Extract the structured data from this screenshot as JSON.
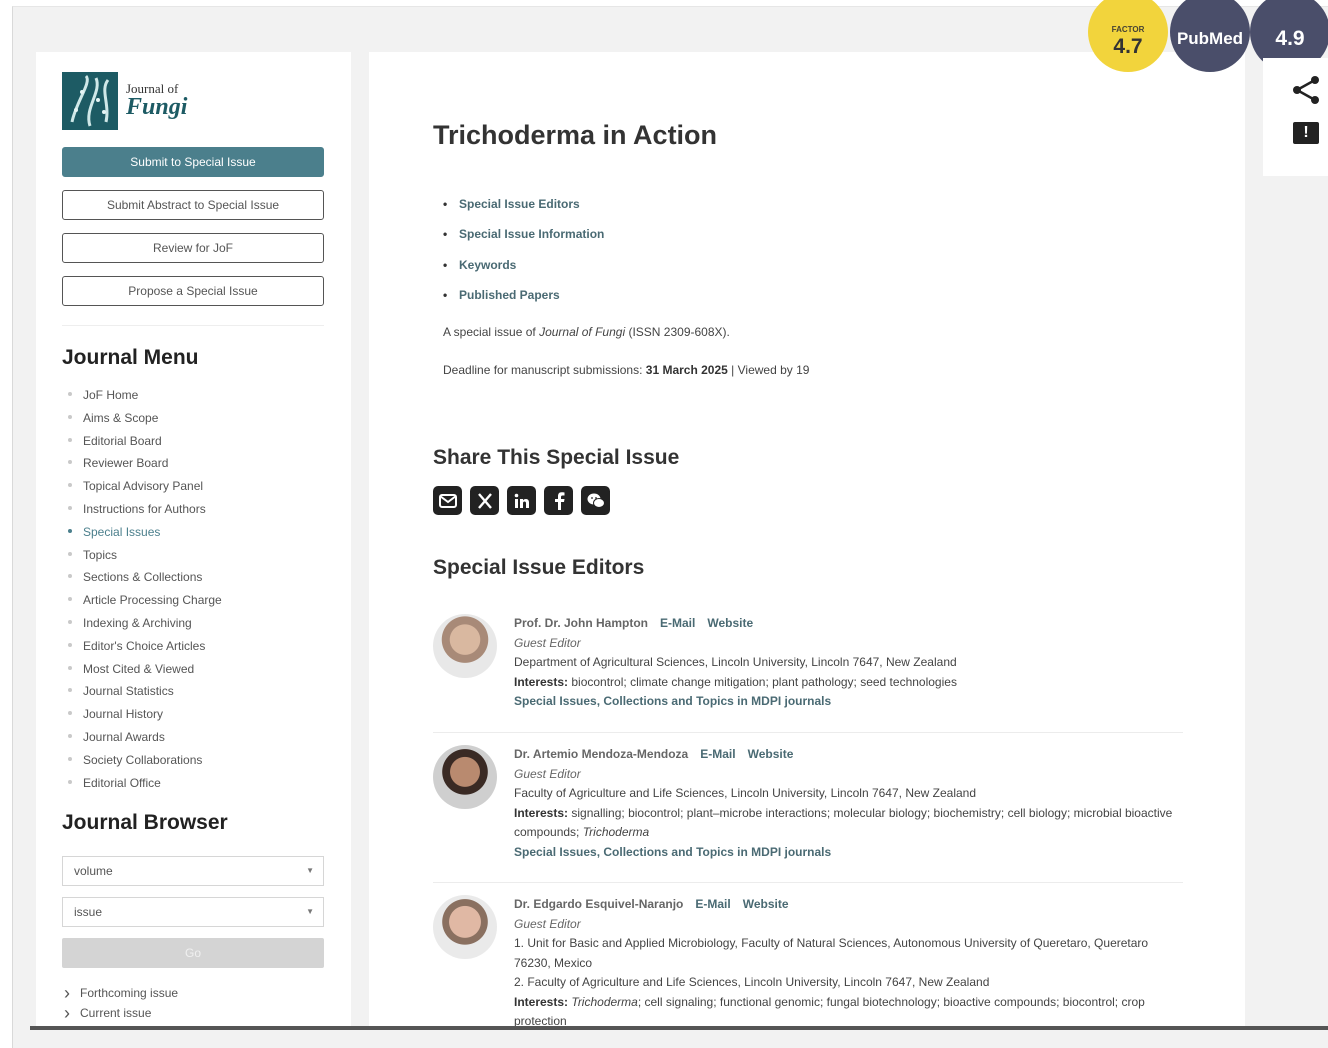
{
  "journal": {
    "small": "Journal of",
    "big": "Fungi"
  },
  "sidebar": {
    "buttons": [
      "Submit to Special Issue",
      "Submit Abstract to Special Issue",
      "Review for JoF",
      "Propose a Special Issue"
    ],
    "menu_title": "Journal Menu",
    "menu": [
      "JoF Home",
      "Aims & Scope",
      "Editorial Board",
      "Reviewer Board",
      "Topical Advisory Panel",
      "Instructions for Authors",
      "Special Issues",
      "Topics",
      "Sections & Collections",
      "Article Processing Charge",
      "Indexing & Archiving",
      "Editor's Choice Articles",
      "Most Cited & Viewed",
      "Journal Statistics",
      "Journal History",
      "Journal Awards",
      "Society Collaborations",
      "Editorial Office"
    ],
    "active_menu": "Special Issues",
    "browser_title": "Journal Browser",
    "volume_select": "volume",
    "issue_select": "issue",
    "go_label": "Go",
    "browse_links": [
      "Forthcoming issue",
      "Current issue"
    ]
  },
  "badges": {
    "impact_label": "FACTOR",
    "impact_value": "4.7",
    "pubmed": "PubMed",
    "citescore_value": "4.9"
  },
  "main": {
    "title": "Trichoderma in Action",
    "toc": [
      "Special Issue Editors",
      "Special Issue Information",
      "Keywords",
      "Published Papers"
    ],
    "issue_line": {
      "prefix": "A special issue of ",
      "journal": "Journal of Fungi",
      "suffix": " (ISSN 2309-608X)."
    },
    "deadline": {
      "prefix": "Deadline for manuscript submissions: ",
      "date": "31 March 2025",
      "suffix": " | Viewed by 19"
    },
    "share_heading": "Share This Special Issue",
    "share_icons": [
      "email-icon",
      "x-icon",
      "linkedin-icon",
      "facebook-icon",
      "wechat-icon"
    ],
    "editors_heading": "Special Issue Editors",
    "editors": [
      {
        "name": "Prof. Dr. John Hampton",
        "email": "E-Mail",
        "website": "Website",
        "role": "Guest Editor",
        "affiliation": "Department of Agricultural Sciences, Lincoln University, Lincoln 7647, New Zealand",
        "interests_label": "Interests:",
        "interests": " biocontrol; climate change mitigation; plant pathology; seed technologies",
        "more": "Special Issues, Collections and Topics in MDPI journals"
      },
      {
        "name": "Dr. Artemio Mendoza-Mendoza",
        "email": "E-Mail",
        "website": "Website",
        "role": "Guest Editor",
        "affiliation": "Faculty of Agriculture and Life Sciences, Lincoln University, Lincoln 7647, New Zealand",
        "interests_label": "Interests:",
        "interests": " signalling; biocontrol; plant–microbe interactions; molecular biology; biochemistry; cell biology; microbial bioactive compounds; ",
        "interests_italic": "Trichoderma",
        "more": "Special Issues, Collections and Topics in MDPI journals"
      },
      {
        "name": "Dr. Edgardo Esquivel-Naranjo",
        "email": "E-Mail",
        "website": "Website",
        "role": "Guest Editor",
        "affiliation1": "1. Unit for Basic and Applied Microbiology, Faculty of Natural Sciences, Autonomous University of Queretaro, Queretaro 76230, Mexico",
        "affiliation2": "2. Faculty of Agriculture and Life Sciences, Lincoln University, Lincoln 7647, New Zealand",
        "interests_label": "Interests:",
        "interests_italic": "Trichoderma",
        "interests": "; cell signaling; functional genomic; fungal biotechnology; bioactive compounds; biocontrol; crop protection"
      }
    ]
  }
}
